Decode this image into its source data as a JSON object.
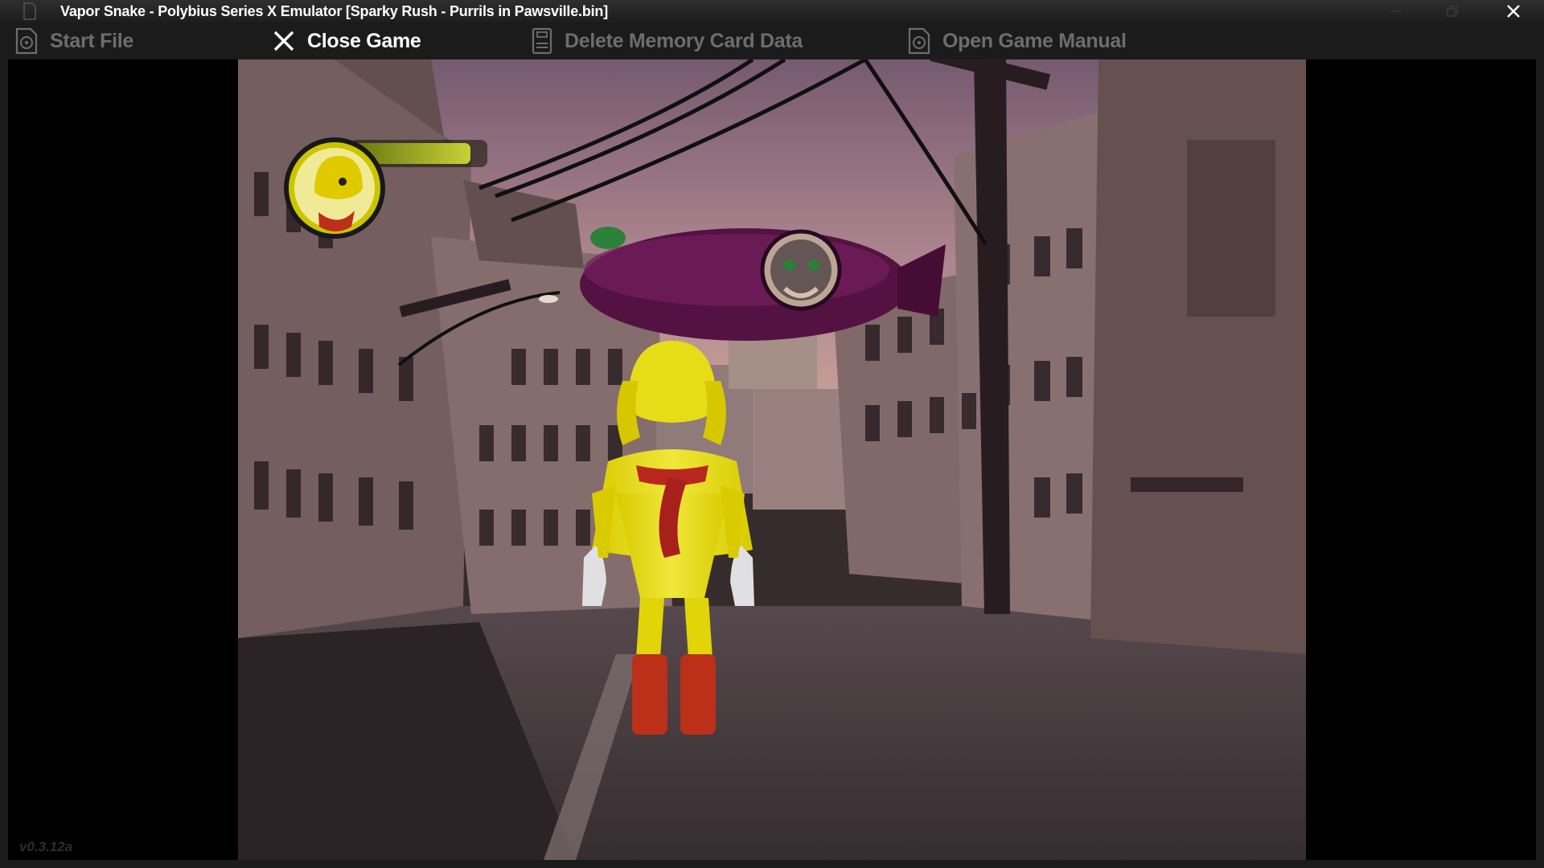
{
  "window": {
    "title": "Vapor Snake - Polybius Series X Emulator [Sparky Rush - Purrils in Pawsville.bin]"
  },
  "menu": {
    "start_file": "Start File",
    "close_game": "Close Game",
    "delete_memory": "Delete Memory Card Data",
    "open_manual": "Open Game Manual"
  },
  "hud": {
    "health_fraction": 0.9
  },
  "version": "v0.3.12a",
  "colors": {
    "active_text": "#ffffff",
    "inactive_text": "#6d6d6d",
    "health_bar": "#c6d12a"
  }
}
